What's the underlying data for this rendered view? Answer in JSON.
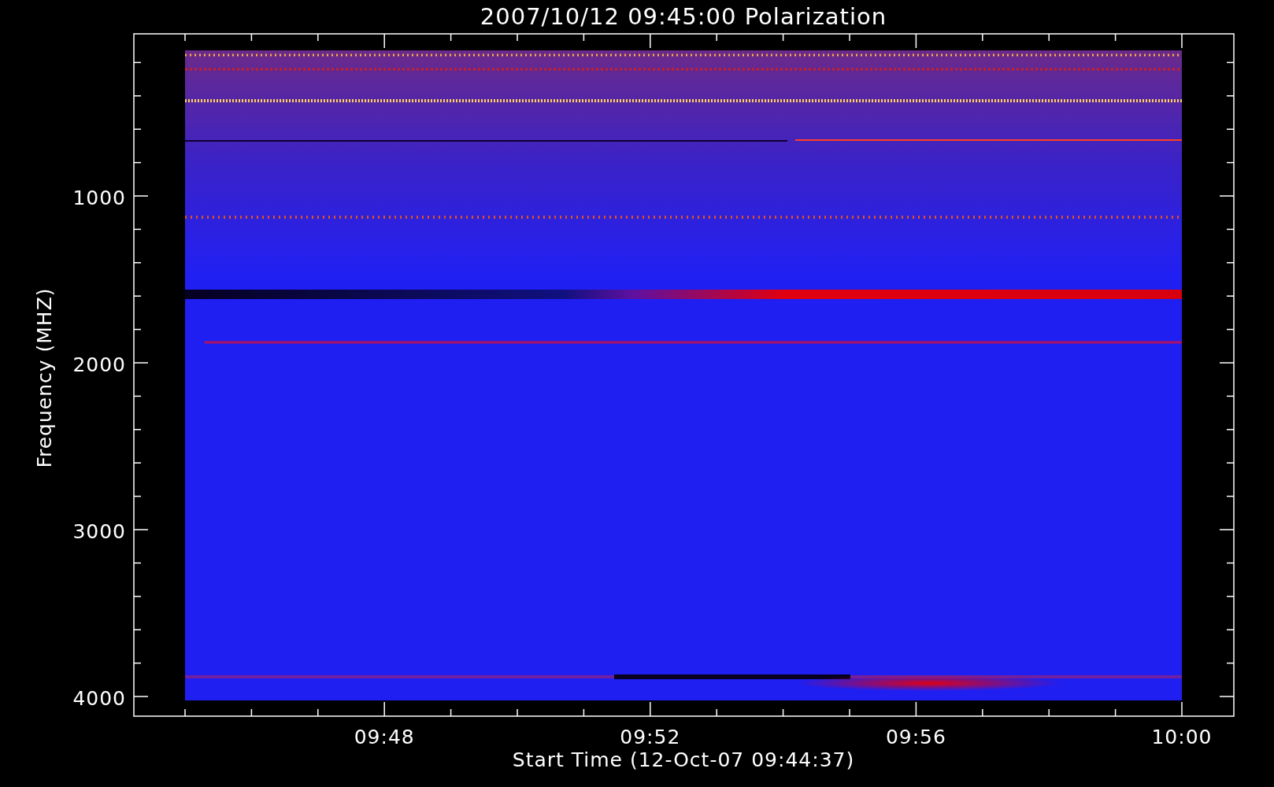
{
  "title": "2007/10/12 09:45:00 Polarization",
  "y_axis": {
    "label": "Frequency (MHZ)",
    "tick_labels": [
      "1000",
      "2000",
      "3000",
      "4000"
    ]
  },
  "x_axis": {
    "label": "Start Time (12-Oct-07 09:44:37)",
    "tick_labels": [
      "09:48",
      "09:52",
      "09:56",
      "10:00"
    ]
  }
}
